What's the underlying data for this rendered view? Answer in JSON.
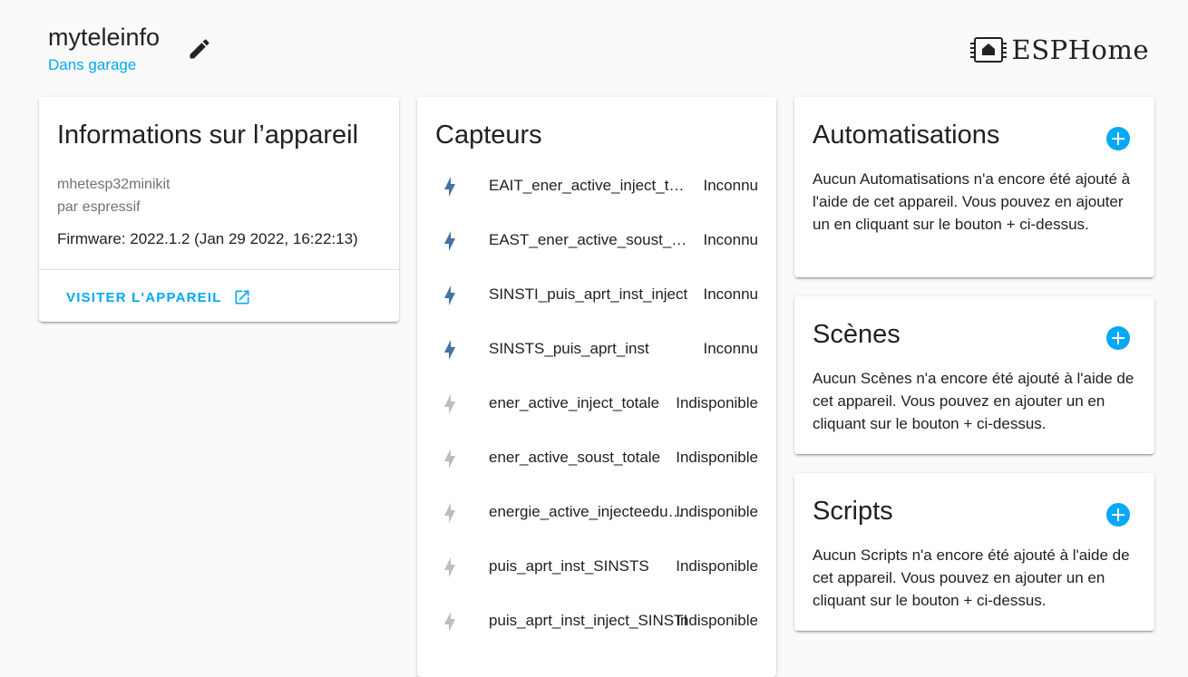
{
  "device": {
    "name": "myteleinfo",
    "area": "Dans garage"
  },
  "logo": {
    "text": "ESPHome"
  },
  "info_card": {
    "title": "Informations sur l’appareil",
    "model": "mhetesp32minikit",
    "manufacturer": "par espressif",
    "firmware": "Firmware: 2022.1.2 (Jan 29 2022, 16:22:13)",
    "visit_label": "VISITER L'APPAREIL"
  },
  "sensors_card": {
    "title": "Capteurs",
    "items": [
      {
        "name": "EAIT_ener_active_inject_totale",
        "state": "Inconnu",
        "icon": "flash-icon",
        "available": true
      },
      {
        "name": "EAST_ener_active_soust_totale",
        "state": "Inconnu",
        "icon": "flash-icon",
        "available": true
      },
      {
        "name": "SINSTI_puis_aprt_inst_inject",
        "state": "Inconnu",
        "icon": "flash-icon",
        "available": true
      },
      {
        "name": "SINSTS_puis_aprt_inst",
        "state": "Inconnu",
        "icon": "flash-icon",
        "available": true
      },
      {
        "name": "ener_active_inject_totale",
        "state": "Indisponible",
        "icon": "flash-icon",
        "available": false
      },
      {
        "name": "ener_active_soust_totale",
        "state": "Indisponible",
        "icon": "flash-icon",
        "available": false
      },
      {
        "name": "energie_active_injecteedu_jour",
        "state": "Indisponible",
        "icon": "flash-icon",
        "available": false
      },
      {
        "name": "puis_aprt_inst_SINSTS",
        "state": "Indisponible",
        "icon": "flash-icon",
        "available": false
      },
      {
        "name": "puis_aprt_inst_inject_SINSTI",
        "state": "Indisponible",
        "icon": "flash-icon",
        "available": false
      }
    ]
  },
  "automations_card": {
    "title": "Automatisations",
    "description": "Aucun Automatisations n'a encore été ajouté à l'aide de cet appareil. Vous pouvez en ajouter un en cliquant sur le bouton + ci-dessus."
  },
  "scenes_card": {
    "title": "Scènes",
    "description": "Aucun Scènes n'a encore été ajouté à l'aide de cet appareil. Vous pouvez en ajouter un en cliquant sur le bouton + ci-dessus."
  },
  "scripts_card": {
    "title": "Scripts",
    "description": "Aucun Scripts n'a encore été ajouté à l'aide de cet appareil. Vous pouvez en ajouter un en cliquant sur le bouton + ci-dessus."
  },
  "colors": {
    "accent": "#03a9f4",
    "icon_active": "#44739e",
    "icon_unavailable": "#bdbdbd"
  }
}
